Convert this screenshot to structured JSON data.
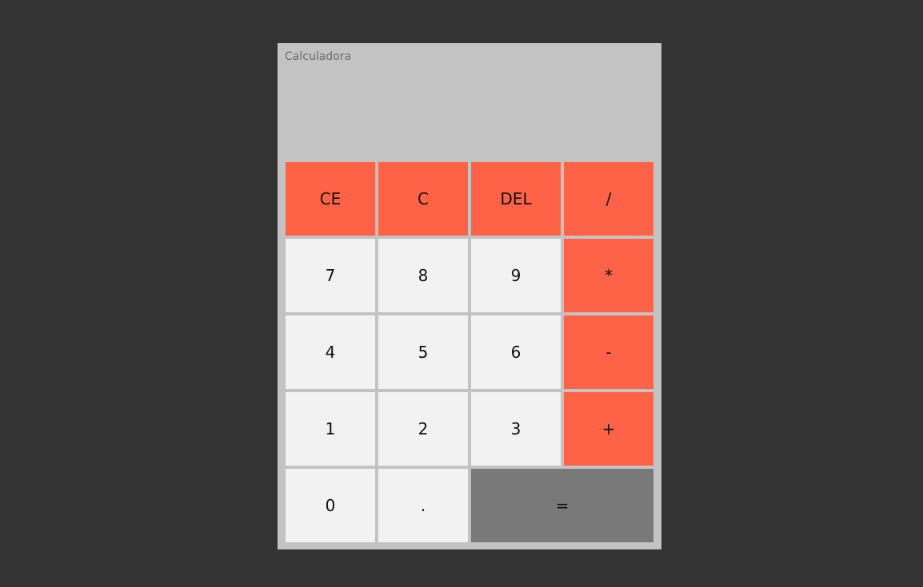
{
  "calculator": {
    "title": "Calculadora",
    "display_value": ""
  },
  "keys": {
    "ce": "CE",
    "c": "C",
    "del": "DEL",
    "divide": "/",
    "seven": "7",
    "eight": "8",
    "nine": "9",
    "multiply": "*",
    "four": "4",
    "five": "5",
    "six": "6",
    "subtract": "-",
    "one": "1",
    "two": "2",
    "three": "3",
    "add": "+",
    "zero": "0",
    "decimal": ".",
    "equals": "="
  },
  "colors": {
    "background": "#333333",
    "panel": "#c3c3c3",
    "operator_key": "#ff6347",
    "number_key": "#f2f2f2",
    "equals_key": "#797979"
  }
}
